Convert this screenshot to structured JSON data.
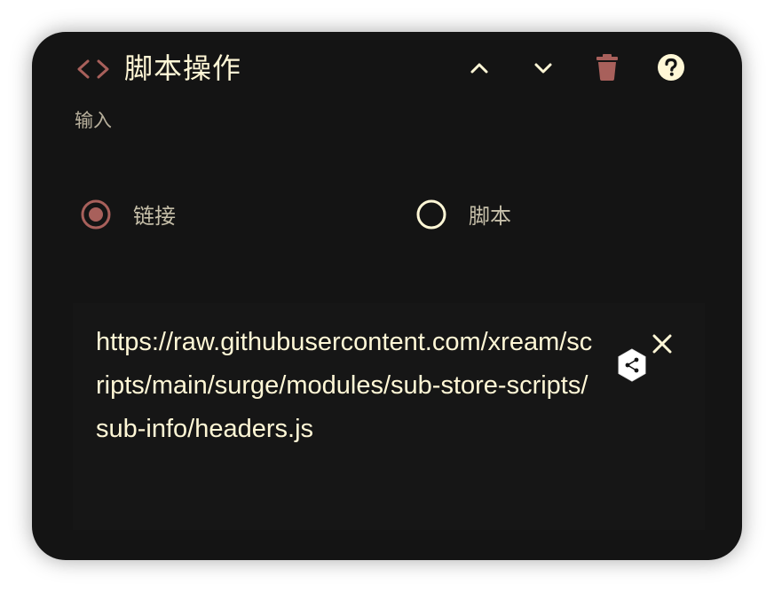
{
  "header": {
    "title": "脚本操作",
    "subtitle": "输入",
    "icons": {
      "code": "code-icon",
      "move_up": "chevron-up-icon",
      "move_down": "chevron-down-icon",
      "delete": "trash-icon",
      "help": "help-icon"
    }
  },
  "mode": {
    "options": [
      {
        "label": "链接",
        "selected": true
      },
      {
        "label": "脚本",
        "selected": false
      }
    ]
  },
  "input": {
    "value": "https://raw.githubusercontent.com/xream/scripts/main/surge/modules/sub-store-scripts/sub-info/headers.js",
    "clear_icon": "close-icon",
    "overlay_icon": "share-hex-icon"
  },
  "colors": {
    "card_bg": "#141414",
    "title": "#fff7d6",
    "accent_red": "#a8605b",
    "subtle_text": "#b8b09c",
    "radio_unselected": "#fff7d6"
  }
}
